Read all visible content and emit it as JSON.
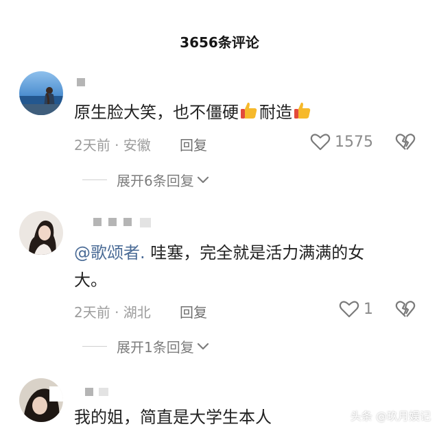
{
  "header": {
    "title": "3656条评论"
  },
  "comments": [
    {
      "text_before": "原生脸大笑，也不僵硬",
      "text_middle": "耐造",
      "meta": "2天前 · 安徽",
      "reply_label": "回复",
      "likes": "1575",
      "expand_label": "展开6条回复"
    },
    {
      "mention": "@歌颂者.",
      "text": " 哇塞，完全就是活力满满的女",
      "text_line2": "大。",
      "meta": "2天前 · 湖北",
      "reply_label": "回复",
      "likes": "1",
      "expand_label": "展开1条回复"
    },
    {
      "text": "我的姐，简直是大学生本人"
    }
  ],
  "watermark": "头条 @玖月娱记",
  "icons": {
    "thumbs_up": "thumbs-up-emoji",
    "heart": "heart-outline-icon",
    "broken_heart": "broken-heart-icon",
    "chevron": "chevron-down-icon"
  },
  "colors": {
    "mention": "#4a6b96",
    "meta": "#9c9c9c"
  }
}
